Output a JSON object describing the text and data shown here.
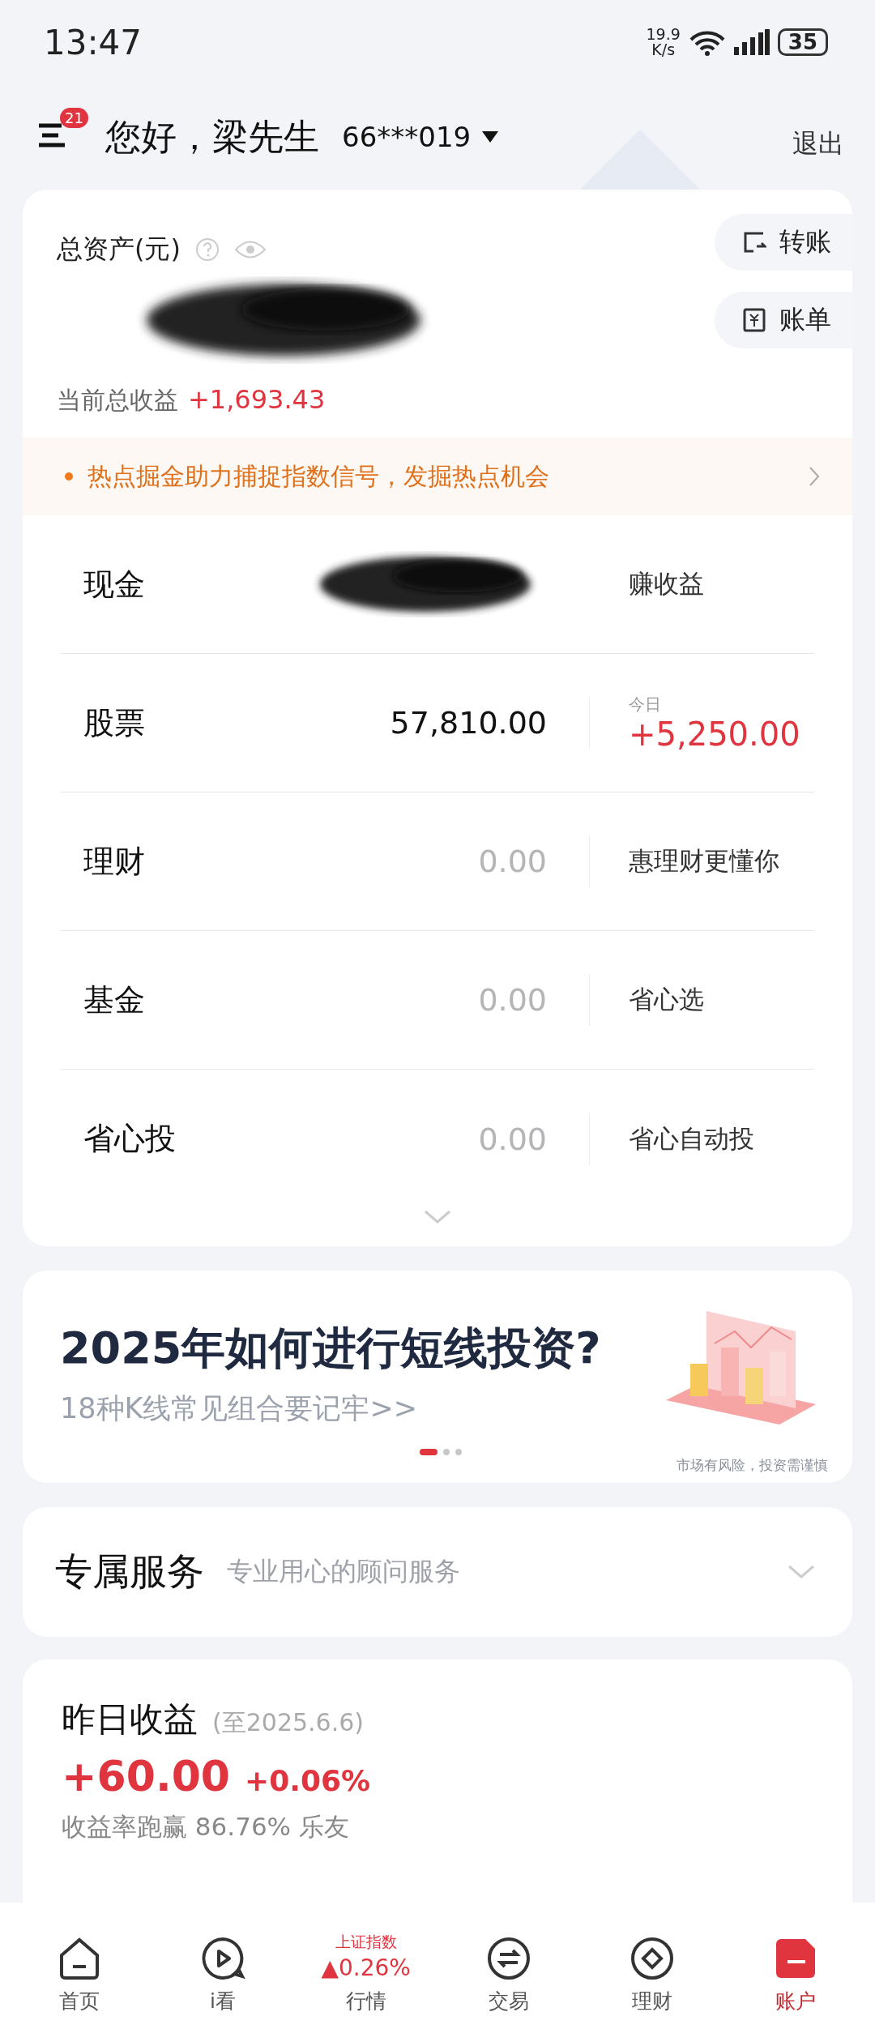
{
  "status_bar": {
    "time": "13:47",
    "speed_value": "19.9",
    "speed_unit": "K/s",
    "battery": "35"
  },
  "header": {
    "badge": "21",
    "greeting": "您好，梁先生",
    "account": "66***019",
    "logout": "退出"
  },
  "assets": {
    "title": "总资产(元)",
    "value_redacted": true,
    "actions": [
      "转账",
      "账单"
    ],
    "profit_label": "当前总收益",
    "profit_value": "+1,693.43"
  },
  "notice": {
    "text": "热点掘金助力捕捉指数信号，发掘热点机会"
  },
  "rows": [
    {
      "label": "现金",
      "redacted": true,
      "kind": "text",
      "note": "赚收益"
    },
    {
      "label": "股票",
      "redacted": false,
      "value": "57,810.00",
      "muted": false,
      "kind": "gain",
      "caption": "今日",
      "note": "+5,250.00"
    },
    {
      "label": "理财",
      "redacted": false,
      "value": "0.00",
      "muted": true,
      "kind": "text",
      "note": "惠理财更懂你"
    },
    {
      "label": "基金",
      "redacted": false,
      "value": "0.00",
      "muted": true,
      "kind": "text",
      "note": "省心选"
    },
    {
      "label": "省心投",
      "redacted": false,
      "value": "0.00",
      "muted": true,
      "kind": "text",
      "note": "省心自动投"
    }
  ],
  "banner": {
    "title": "2025年如何进行短线投资?",
    "subtitle": "18种K线常见组合要记牢>>",
    "disclaimer": "市场有风险，投资需谨慎",
    "dots": [
      {
        "selected": true
      },
      {
        "selected": false
      },
      {
        "selected": false
      }
    ]
  },
  "service": {
    "title": "专属服务",
    "subtitle": "专业用心的顾问服务",
    "expanded": false
  },
  "yesterday": {
    "title": "昨日收益",
    "date": "(至2025.6.6)",
    "amount": "+60.00",
    "percent": "+0.06%",
    "rank": "收益率跑赢 86.76% 乐友"
  },
  "tabs": [
    {
      "kind": "icon",
      "label": "首页",
      "selected": false
    },
    {
      "kind": "icon",
      "label": "i看",
      "selected": false
    },
    {
      "kind": "index",
      "label": "行情",
      "index_name": "上证指数",
      "index_change": "▲0.26%",
      "selected": false
    },
    {
      "kind": "icon",
      "label": "交易",
      "selected": false
    },
    {
      "kind": "icon",
      "label": "理财",
      "selected": false
    },
    {
      "kind": "icon",
      "label": "账户",
      "selected": true
    }
  ]
}
